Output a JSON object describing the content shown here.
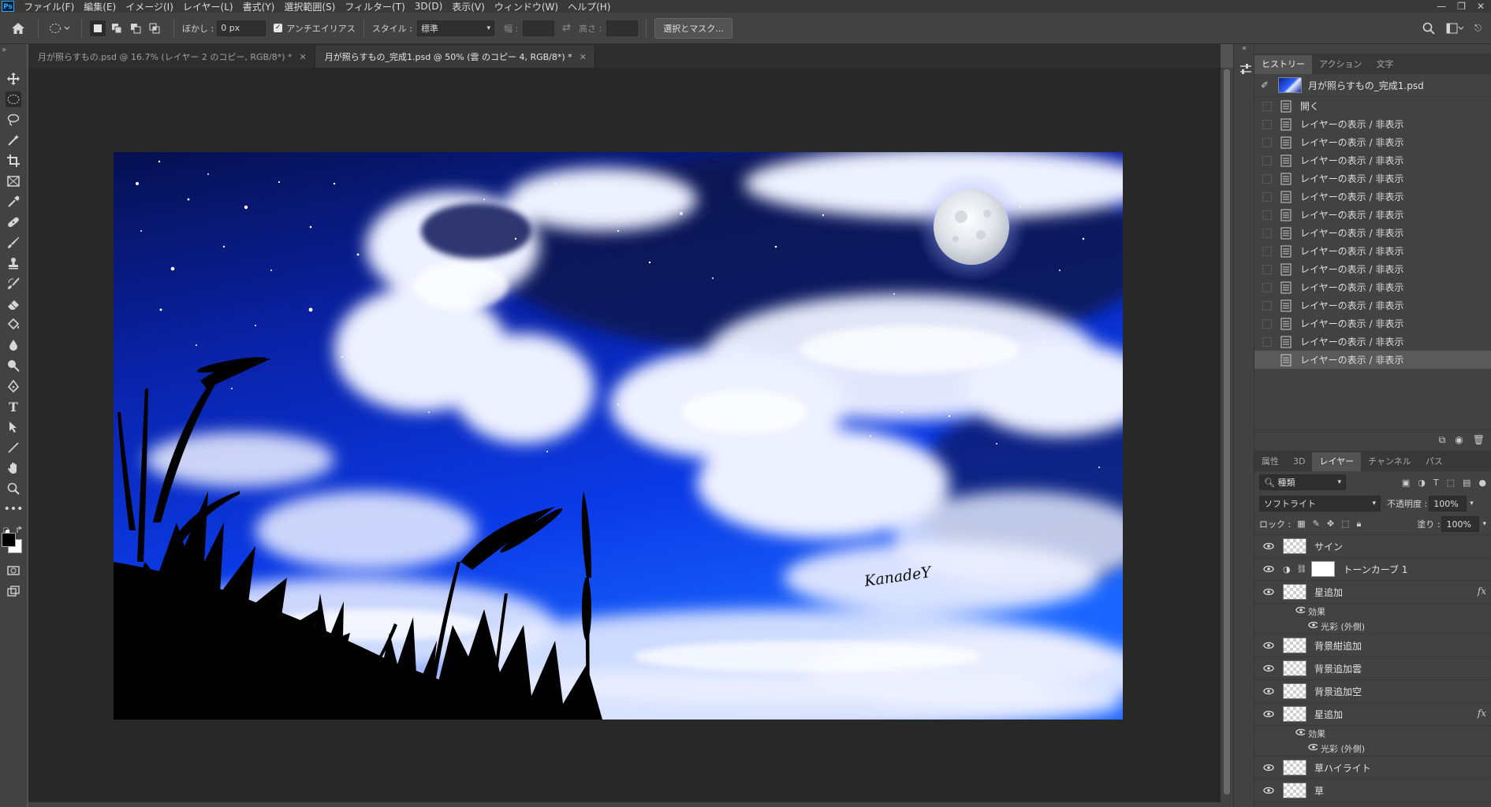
{
  "menubar": {
    "logo": "Ps",
    "items": [
      "ファイル(F)",
      "編集(E)",
      "イメージ(I)",
      "レイヤー(L)",
      "書式(Y)",
      "選択範囲(S)",
      "フィルター(T)",
      "3D(D)",
      "表示(V)",
      "ウィンドウ(W)",
      "ヘルプ(H)"
    ],
    "window_controls": [
      "—",
      "❐",
      "✕"
    ]
  },
  "options": {
    "feather_label": "ぼかし :",
    "feather_value": "0 px",
    "antialias_label": "アンチエイリアス",
    "style_label": "スタイル :",
    "style_value": "標準",
    "width_label": "幅 :",
    "height_label": "高さ :",
    "select_mask_button": "選択とマスク..."
  },
  "tabs": [
    {
      "label": "月が照らすもの.psd @ 16.7% (レイヤー 2 のコピー, RGB/8*) *",
      "close": "✕"
    },
    {
      "label": "月が照らすもの_完成1.psd @ 50% (雲 のコピー 4, RGB/8*) *",
      "close": "✕"
    }
  ],
  "history_panel": {
    "tabs": [
      "ヒストリー",
      "アクション",
      "文字"
    ],
    "snapshot": "月が照らすもの_完成1.psd",
    "items": [
      "開く",
      "レイヤーの表示 / 非表示",
      "レイヤーの表示 / 非表示",
      "レイヤーの表示 / 非表示",
      "レイヤーの表示 / 非表示",
      "レイヤーの表示 / 非表示",
      "レイヤーの表示 / 非表示",
      "レイヤーの表示 / 非表示",
      "レイヤーの表示 / 非表示",
      "レイヤーの表示 / 非表示",
      "レイヤーの表示 / 非表示",
      "レイヤーの表示 / 非表示",
      "レイヤーの表示 / 非表示",
      "レイヤーの表示 / 非表示",
      "レイヤーの表示 / 非表示"
    ]
  },
  "layers_panel": {
    "tabs": [
      "属性",
      "3D",
      "レイヤー",
      "チャンネル",
      "パス"
    ],
    "filter_kind": "種類",
    "blend_mode": "ソフトライト",
    "opacity_label": "不透明度 :",
    "opacity_value": "100%",
    "lock_label": "ロック :",
    "fill_label": "塗り :",
    "fill_value": "100%",
    "layers": [
      {
        "name": "サイン"
      },
      {
        "name": "トーンカーブ 1"
      },
      {
        "name": "星追加",
        "fx": "fx",
        "effects_label": "効果",
        "effect": "光彩 (外側)"
      },
      {
        "name": "背景紺追加"
      },
      {
        "name": "背景追加雲"
      },
      {
        "name": "背景追加空"
      },
      {
        "name": "星追加",
        "fx": "fx",
        "effects_label": "効果",
        "effect": "光彩 (外側)"
      },
      {
        "name": "草ハイライト"
      },
      {
        "name": "草"
      }
    ]
  },
  "artwork": {
    "signature": "KanadeY"
  },
  "colors": {
    "foreground": "#000000",
    "background": "#ffffff",
    "sky_deep": "#0a1a8a",
    "sky_bright": "#0e3fe0",
    "panel_bg": "#424242"
  }
}
